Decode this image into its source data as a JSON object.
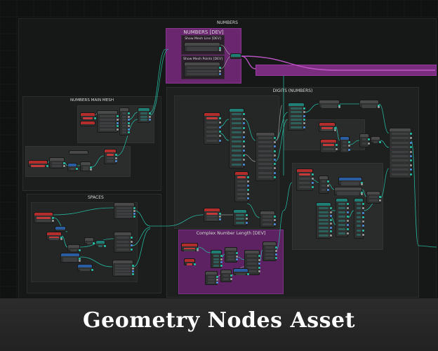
{
  "caption": "Geometry Nodes Asset",
  "frames": {
    "numbers": "NUMBERS",
    "numbers_dev": "NUMBERS [DEV]",
    "show_mesh_line": "Show Mesh Line [DEV]",
    "show_mesh_points": "Show Mesh Points [DEV]",
    "digits": "DIGITS (NUMBERS)",
    "numbers_main_mesh": "NUMBERS MAIN MESH",
    "spaces": "SPACES",
    "complex_number_length": "Complex Number Length [DEV]"
  },
  "colors": {
    "canvas": "#0f1210",
    "frame_purple": "#7a2c7e",
    "frame_dark": "#1b1c1c",
    "node_body": "#2f3030",
    "hdr_red": "#b32d2d",
    "hdr_teal": "#1f7f74",
    "hdr_blue": "#2a5d9f",
    "hdr_gray": "#4a4a4a",
    "wire_teal": "#28c2a6",
    "wire_gray": "#9a9a9a",
    "wire_purple": "#c85bd0",
    "wire_blue": "#4f8fe0"
  }
}
